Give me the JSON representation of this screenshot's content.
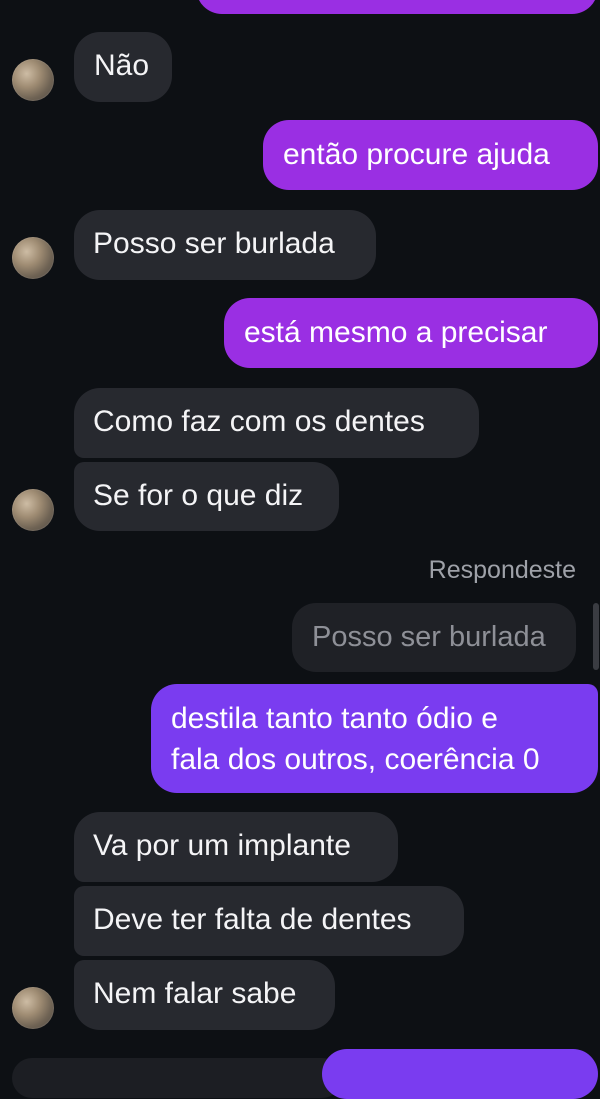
{
  "messages": [
    {
      "id": "m0",
      "side": "out",
      "text": ""
    },
    {
      "id": "m1",
      "side": "in",
      "text": "Não"
    },
    {
      "id": "m2",
      "side": "out",
      "text": "então procure ajuda"
    },
    {
      "id": "m3",
      "side": "in",
      "text": "Posso ser burlada"
    },
    {
      "id": "m4",
      "side": "out",
      "text": "está mesmo a precisar"
    },
    {
      "id": "m5",
      "side": "in",
      "text": "Como faz com os dentes"
    },
    {
      "id": "m6",
      "side": "in",
      "text": "Se for o que diz"
    },
    {
      "id": "m7",
      "side": "out",
      "reply_label": "Respondeste",
      "quoted": "Posso ser burlada",
      "text_line1": "destila tanto tanto ódio e",
      "text_line2": "fala dos outros, coerência 0"
    },
    {
      "id": "m8",
      "side": "in",
      "text": "Va por um implante"
    },
    {
      "id": "m9",
      "side": "in",
      "text": "Deve ter falta de dentes"
    },
    {
      "id": "m10",
      "side": "in",
      "text": "Nem falar sabe"
    }
  ],
  "colors": {
    "background": "#0d1014",
    "incoming": "#27292f",
    "outgoing_purple": "#9a2fe3",
    "outgoing_violet": "#7a3cf0"
  },
  "icons": [
    "contact-avatar"
  ]
}
